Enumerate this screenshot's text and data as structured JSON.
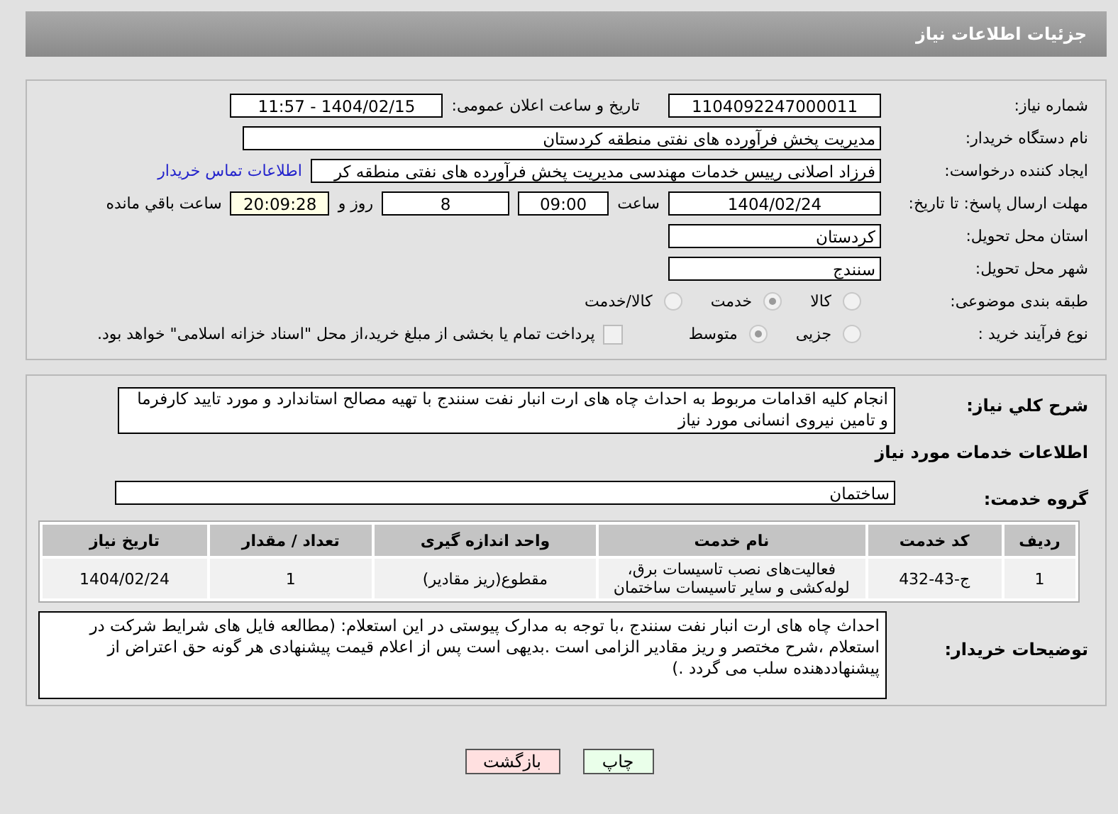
{
  "header": {
    "title": "جزئیات اطلاعات نیاز"
  },
  "need_number": {
    "label": "شماره نیاز:",
    "value": "1104092247000011"
  },
  "announce": {
    "label": "تاریخ و ساعت اعلان عمومی:",
    "value": "1404/02/15 - 11:57"
  },
  "buyer": {
    "label": "نام دستگاه خریدار:",
    "value": "مدیریت پخش فرآورده های نفتی منطقه کردستان"
  },
  "creator": {
    "label": "ایجاد کننده درخواست:",
    "value": "فرزاد اصلانی رییس خدمات مهندسی مدیریت پخش فرآورده های نفتی منطقه کر",
    "link": "اطلاعات تماس خریدار"
  },
  "deadline": {
    "label": "مهلت ارسال پاسخ: تا تاریخ:",
    "date": "1404/02/24",
    "time_label": "ساعت",
    "time": "09:00",
    "days": "8",
    "days_label": "روز و",
    "remaining": "20:09:28",
    "remaining_label": "ساعت باقي مانده"
  },
  "province": {
    "label": "استان محل تحویل:",
    "value": "کردستان"
  },
  "city": {
    "label": "شهر محل تحویل:",
    "value": "سنندج"
  },
  "category": {
    "label": "طبقه بندی موضوعی:",
    "options": [
      {
        "label": "کالا",
        "selected": false
      },
      {
        "label": "خدمت",
        "selected": true
      },
      {
        "label": "کالا/خدمت",
        "selected": false
      }
    ]
  },
  "purchase_type": {
    "label": "نوع فرآیند خرید :",
    "options": [
      {
        "label": "جزیی",
        "selected": false
      },
      {
        "label": "متوسط",
        "selected": true
      }
    ],
    "payment": {
      "checked": false,
      "text": "پرداخت تمام یا بخشی از مبلغ خرید،از محل \"اسناد خزانه اسلامی\" خواهد بود."
    }
  },
  "summary": {
    "label": "شرح كلي نياز:",
    "value": "انجام کلیه اقدامات مربوط به احداث چاه های ارت انبار نفت سنندج با تهیه مصالح استاندارد و مورد تایید کارفرما و تامین نیروی انسانی مورد نیاز"
  },
  "services_title": "اطلاعات خدمات مورد نياز",
  "service_group": {
    "label": "گروه خدمت:",
    "value": "ساختمان"
  },
  "table": {
    "columns": [
      "ردیف",
      "کد خدمت",
      "نام خدمت",
      "واحد اندازه گیری",
      "تعداد / مقدار",
      "تاریخ نیاز"
    ],
    "rows": [
      [
        "1",
        "ج-43-432",
        "فعالیت‌های نصب تاسیسات برق، لوله‌کشی و سایر تاسیسات ساختمان",
        "مقطوع(ریز مقادیر)",
        "1",
        "1404/02/24"
      ]
    ]
  },
  "buyer_notes": {
    "label": "توضیحات خریدار:",
    "value": "احداث چاه های ارت انبار نفت سنندج ،با توجه به مدارک پیوستی در این استعلام: (مطالعه فایل های شرایط شرکت در استعلام ،شرح مختصر و ریز مقادیر  الزامی است .بدیهی است پس از اعلام قیمت پیشنهادی هر گونه حق اعتراض از پیشنهاددهنده سلب می گردد .)"
  },
  "buttons": [
    {
      "label": "چاپ",
      "kind": "print"
    },
    {
      "label": "بازگشت",
      "kind": "back"
    }
  ]
}
